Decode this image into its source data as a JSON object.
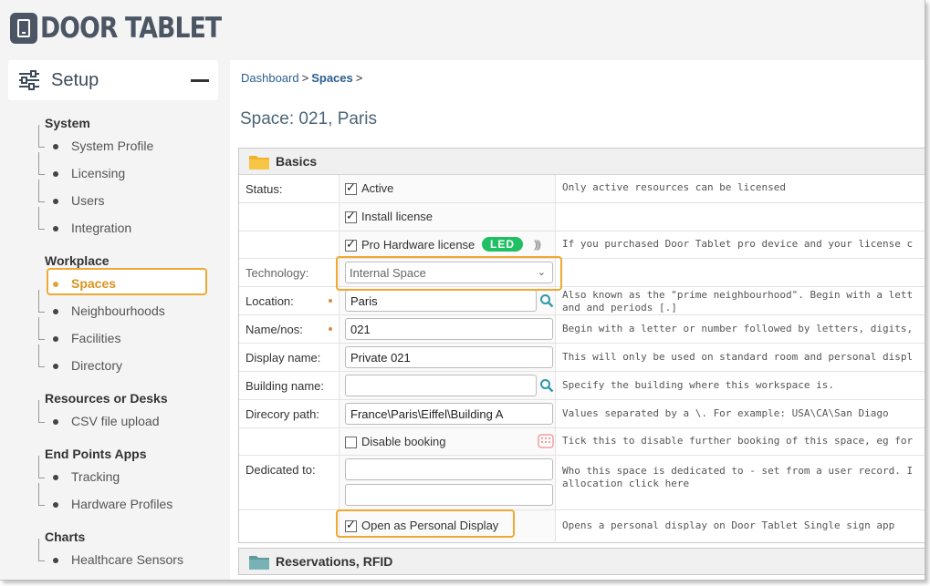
{
  "brand": {
    "name": "DOOR TABLET",
    "color": "#4b5563"
  },
  "sidebar": {
    "title": "Setup",
    "groups": [
      {
        "label": "System",
        "items": [
          "System Profile",
          "Licensing",
          "Users",
          "Integration"
        ]
      },
      {
        "label": "Workplace",
        "items": [
          "Spaces",
          "Neighbourhoods",
          "Facilities",
          "Directory"
        ]
      },
      {
        "label": "Resources or Desks",
        "items": [
          "CSV file upload"
        ]
      },
      {
        "label": "End Points Apps",
        "items": [
          "Tracking",
          "Hardware Profiles"
        ]
      },
      {
        "label": "Charts",
        "items": [
          "Healthcare Sensors"
        ]
      }
    ],
    "active_item": "Spaces",
    "accent": "#f0a830"
  },
  "breadcrumb": {
    "root": "Dashboard",
    "sep": ">",
    "current": "Spaces",
    "trail_sep": ">"
  },
  "page": {
    "title": "Space: 021, Paris"
  },
  "basics": {
    "title": "Basics",
    "status_label": "Status:",
    "active_label": "Active",
    "active_checked": true,
    "active_help": "Only active resources can be licensed",
    "install_label": "Install license",
    "install_checked": true,
    "pro_label": "Pro Hardware license",
    "pro_checked": true,
    "led_badge": "LED",
    "nfc_icon": ")))",
    "pro_help": "If you purchased Door Tablet pro device and your license c",
    "technology_label": "Technology:",
    "technology_value": "Internal Space",
    "location_label": "Location:",
    "location_value": "Paris",
    "location_help_1": "Also known as the \"prime neighbourhood\". Begin with a lett",
    "location_help_2": "and and periods [.]",
    "name_label": "Name/nos:",
    "name_value": "021",
    "name_help": "Begin with a letter or number followed by letters, digits,",
    "display_label": "Display name:",
    "display_value": "Private 021",
    "display_help": "This will only be used on standard room and personal displ",
    "building_label": "Building name:",
    "building_value": "",
    "building_help": "Specify the building where this workspace is.",
    "path_label": "Direcory path:",
    "path_value": "France\\Paris\\Eiffel\\Building A",
    "path_help": "Values separated by a \\.  For example: USA\\CA\\San Diago",
    "disable_label": "Disable booking",
    "disable_checked": false,
    "disable_help": "Tick this to disable further booking of this space, eg for",
    "dedicated_label": "Dedicated to:",
    "dedicated_value_1": "",
    "dedicated_value_2": "",
    "dedicated_help_1": "Who this space is dedicated to - set from a user record. I",
    "dedicated_help_2": "allocation click here",
    "personal_label": "Open as Personal Display",
    "personal_checked": true,
    "personal_help": "Opens a personal display on Door Tablet Single sign app"
  },
  "reservations": {
    "title": "Reservations, RFID"
  },
  "colors": {
    "led": "#1fbf63",
    "link": "#2b5f8f",
    "highlight": "#f0a830"
  }
}
